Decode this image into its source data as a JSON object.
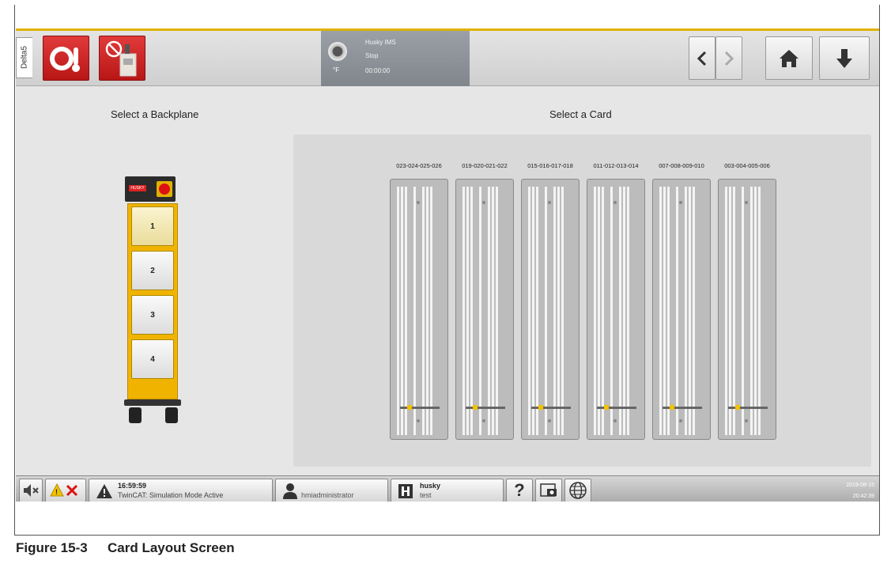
{
  "topbar": {
    "delta_tab": "Delta5",
    "status": {
      "unit": "°F",
      "line1": "Husky IMS",
      "line2": "Stop",
      "line3": "00:00:00"
    }
  },
  "main": {
    "backplane_heading": "Select a Backplane",
    "card_heading": "Select a Card",
    "backplane_logo": "HUSKY",
    "slots": [
      {
        "label": "1",
        "selected": true
      },
      {
        "label": "2",
        "selected": false
      },
      {
        "label": "3",
        "selected": false
      },
      {
        "label": "4",
        "selected": false
      }
    ],
    "cards": [
      "023-024-025-026",
      "019-020-021-022",
      "015-016-017-018",
      "011-012-013-014",
      "007-008-009-010",
      "003-004-005-006"
    ]
  },
  "bottombar": {
    "alarm_time": "16:59:59",
    "alarm_text": "TwinCAT: Simulation Mode Active",
    "user": "hmiadministrator",
    "mold_name": "husky",
    "mold_sub": "test",
    "help": "?",
    "date": "2019-08-15",
    "time": "20:42:39"
  },
  "caption": {
    "number": "Figure 15-3",
    "title": "Card Layout Screen"
  },
  "colors": {
    "accent_yellow": "#f0b400",
    "alarm_red": "#d11",
    "panel_gray": "#e6e6e6"
  }
}
